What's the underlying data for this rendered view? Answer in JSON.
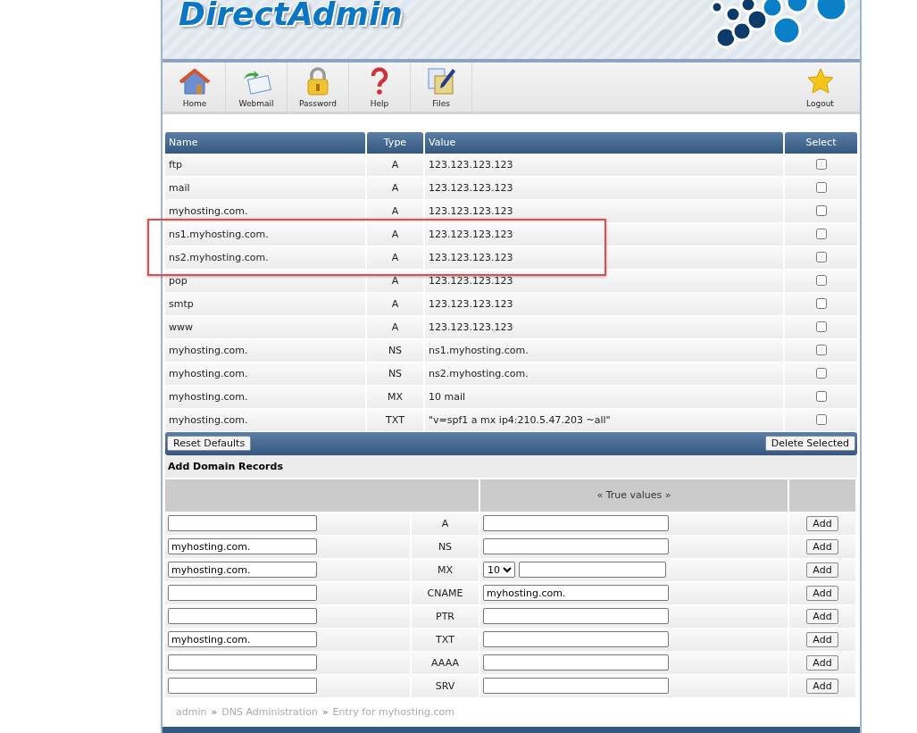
{
  "logo": "DirectAdmin",
  "toolbar": [
    {
      "label": "Home",
      "kind": "home"
    },
    {
      "label": "Webmail",
      "kind": "webmail"
    },
    {
      "label": "Password",
      "kind": "password"
    },
    {
      "label": "Help",
      "kind": "help"
    },
    {
      "label": "Files",
      "kind": "files"
    },
    {
      "label": "Logout",
      "kind": "logout"
    }
  ],
  "records": {
    "columns": [
      "Name",
      "Type",
      "Value",
      "Select"
    ],
    "rows": [
      {
        "name": "ftp",
        "type": "A",
        "value": "123.123.123.123",
        "checked": false,
        "highlighted": false
      },
      {
        "name": "mail",
        "type": "A",
        "value": "123.123.123.123",
        "checked": false,
        "highlighted": false
      },
      {
        "name": "myhosting.com.",
        "type": "A",
        "value": "123.123.123.123",
        "checked": false,
        "highlighted": false
      },
      {
        "name": "ns1.myhosting.com.",
        "type": "A",
        "value": "123.123.123.123",
        "checked": false,
        "highlighted": true
      },
      {
        "name": "ns2.myhosting.com.",
        "type": "A",
        "value": "123.123.123.123",
        "checked": false,
        "highlighted": true
      },
      {
        "name": "pop",
        "type": "A",
        "value": "123.123.123.123",
        "checked": false,
        "highlighted": false
      },
      {
        "name": "smtp",
        "type": "A",
        "value": "123.123.123.123",
        "checked": false,
        "highlighted": false
      },
      {
        "name": "www",
        "type": "A",
        "value": "123.123.123.123",
        "checked": false,
        "highlighted": false
      },
      {
        "name": "myhosting.com.",
        "type": "NS",
        "value": "ns1.myhosting.com.",
        "checked": false,
        "highlighted": false
      },
      {
        "name": "myhosting.com.",
        "type": "NS",
        "value": "ns2.myhosting.com.",
        "checked": false,
        "highlighted": false
      },
      {
        "name": "myhosting.com.",
        "type": "MX",
        "value": "10 mail",
        "checked": false,
        "highlighted": false
      },
      {
        "name": "myhosting.com.",
        "type": "TXT",
        "value": "\"v=spf1 a mx ip4:210.5.47.203 ~all\"",
        "checked": false,
        "highlighted": false
      }
    ],
    "reset_button": "Reset Defaults",
    "delete_button": "Delete Selected"
  },
  "add_records": {
    "title": "Add Domain Records",
    "true_values_header": "« True values »",
    "rows": [
      {
        "name": "",
        "type": "A",
        "value": "",
        "kind": "plain",
        "button": "Add"
      },
      {
        "name": "myhosting.com.",
        "type": "NS",
        "value": "",
        "kind": "plain",
        "button": "Add"
      },
      {
        "name": "myhosting.com.",
        "type": "MX",
        "value": "",
        "kind": "priority",
        "priority": "10",
        "button": "Add"
      },
      {
        "name": "",
        "type": "CNAME",
        "value": "myhosting.com.",
        "kind": "plain",
        "button": "Add"
      },
      {
        "name": "",
        "type": "PTR",
        "value": "",
        "kind": "plain",
        "button": "Add"
      },
      {
        "name": "myhosting.com.",
        "type": "TXT",
        "value": "",
        "kind": "plain",
        "button": "Add"
      },
      {
        "name": "",
        "type": "AAAA",
        "value": "",
        "kind": "plain",
        "button": "Add"
      },
      {
        "name": "",
        "type": "SRV",
        "value": "",
        "kind": "plain",
        "button": "Add"
      }
    ]
  },
  "breadcrumb": [
    {
      "label": "admin"
    },
    {
      "label": "»",
      "kind": "separator"
    },
    {
      "label": "DNS Administration"
    },
    {
      "label": "»",
      "kind": "separator"
    },
    {
      "label": "Entry for myhosting.com"
    }
  ]
}
